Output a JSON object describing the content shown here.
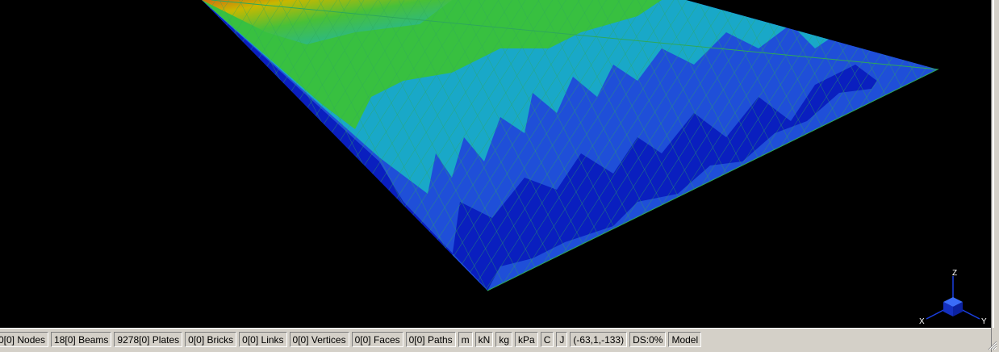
{
  "status_bar": {
    "nodes": "0[0] Nodes",
    "beams": "18[0] Beams",
    "plates": "9278[0] Plates",
    "bricks": "0[0] Bricks",
    "links": "0[0] Links",
    "vertices": "0[0] Vertices",
    "faces": "0[0] Faces",
    "paths": "0[0] Paths",
    "unit_length": "m",
    "unit_force": "kN",
    "unit_mass": "kg",
    "unit_stress": "kPa",
    "unit_temp": "C",
    "unit_energy": "J",
    "cursor_coords": "(-63,1,-133)",
    "ds": "DS:0%",
    "mode": "Model"
  },
  "axis_triad": {
    "z_label": "Z",
    "x_label": "X",
    "y_label": "Y"
  },
  "colors": {
    "background": "#000000",
    "contour_dark_blue": "#0a1fbf",
    "contour_blue": "#1f4fd8",
    "contour_cyan": "#19b8c8",
    "contour_green": "#38c040",
    "contour_yellow": "#c8c800",
    "contour_orange": "#d08010",
    "mesh_lines": "#2ea85a",
    "statusbar_bg": "#d4d0c8"
  },
  "icons": [
    "axis-triad-cube-icon",
    "resize-grip-icon"
  ]
}
